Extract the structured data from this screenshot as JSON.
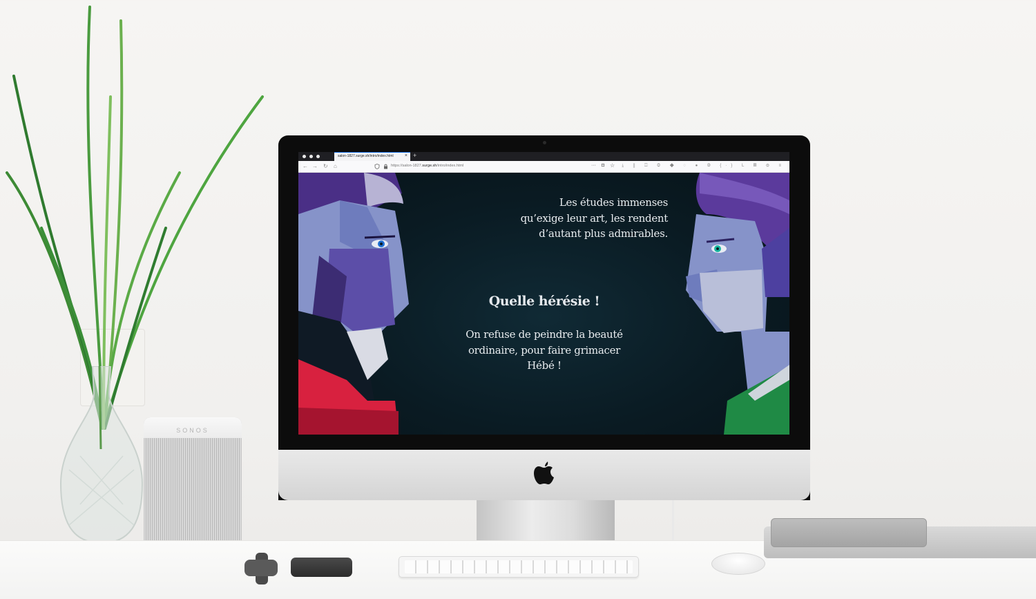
{
  "browser": {
    "tab_title": "salon-1827.surge.sh/intro/index.html",
    "tab_close": "×",
    "new_tab": "+",
    "url_prefix": "https://salon-1827.",
    "url_domain": "surge.sh",
    "url_path": "/intro/index.html",
    "url_more": "···",
    "back_icon": "←",
    "forward_icon": "→",
    "reload_icon": "↻",
    "home_icon": "⌂",
    "toolbar_icons": "⤓ ⫼ ◫ ◎ ◆ ◌ ● ◍ {·} L ▤ ⚙ ≡"
  },
  "page": {
    "quote_top": [
      "Les études immenses",
      "qu’exige leur art, les rendent",
      "d’autant plus admirables."
    ],
    "heading": "Quelle hérésie !",
    "quote_bottom": [
      "On refuse de peindre la beauté",
      "ordinaire, pour faire grimacer",
      "Hébé !"
    ]
  },
  "speaker": {
    "brand": "SONOS"
  },
  "colors": {
    "page_bg": "#0a1b23",
    "left_jacket": "#d8213f",
    "right_jacket": "#1f8a45",
    "hair": "#5b3a9c",
    "skin": "#7d8cc6"
  }
}
